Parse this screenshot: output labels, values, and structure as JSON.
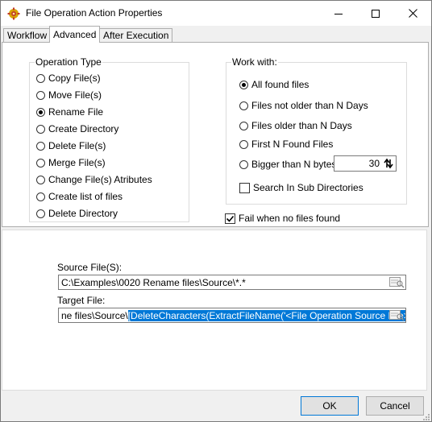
{
  "window": {
    "title": "File Operation Action Properties",
    "controls": {
      "minimize": "minimize-icon",
      "maximize": "maximize-icon",
      "close": "close-icon"
    }
  },
  "tabs": [
    {
      "label": "Workflow",
      "active": false
    },
    {
      "label": "Advanced",
      "active": true
    },
    {
      "label": "After Execution",
      "active": false
    }
  ],
  "operation_type": {
    "legend": "Operation Type",
    "options": [
      {
        "label": "Copy File(s)",
        "checked": false
      },
      {
        "label": "Move File(s)",
        "checked": false
      },
      {
        "label": "Rename File",
        "checked": true
      },
      {
        "label": "Create Directory",
        "checked": false
      },
      {
        "label": "Delete File(s)",
        "checked": false
      },
      {
        "label": "Merge File(s)",
        "checked": false
      },
      {
        "label": "Change File(s) Atributes",
        "checked": false
      },
      {
        "label": "Create list of files",
        "checked": false
      },
      {
        "label": "Delete Directory",
        "checked": false
      }
    ]
  },
  "work_with": {
    "legend": "Work with:",
    "options": [
      {
        "label": "All found files",
        "checked": true
      },
      {
        "label": "Files not older than N Days",
        "checked": false
      },
      {
        "label": "Files older than N Days",
        "checked": false
      },
      {
        "label": "First N Found Files",
        "checked": false
      },
      {
        "label": "Bigger than N bytes",
        "checked": false
      }
    ],
    "n_value": "30",
    "search_subdirs_label": "Search In Sub Directories",
    "search_subdirs_checked": false
  },
  "fail_when_no_files": {
    "label": "Fail when no files found",
    "checked": true
  },
  "source": {
    "label": "Source File(S):",
    "value": "C:\\Examples\\0020 Rename files\\Source\\*.*"
  },
  "target": {
    "label": "Target File:",
    "value_unselected": "ne files\\Source\\",
    "value_selected": "[DeleteCharacters(ExtractFileName('<File Operation Source File>'),' ')]"
  },
  "buttons": {
    "ok": "OK",
    "cancel": "Cancel"
  },
  "colors": {
    "selection": "#0078d7",
    "accent": "#0078d7"
  }
}
